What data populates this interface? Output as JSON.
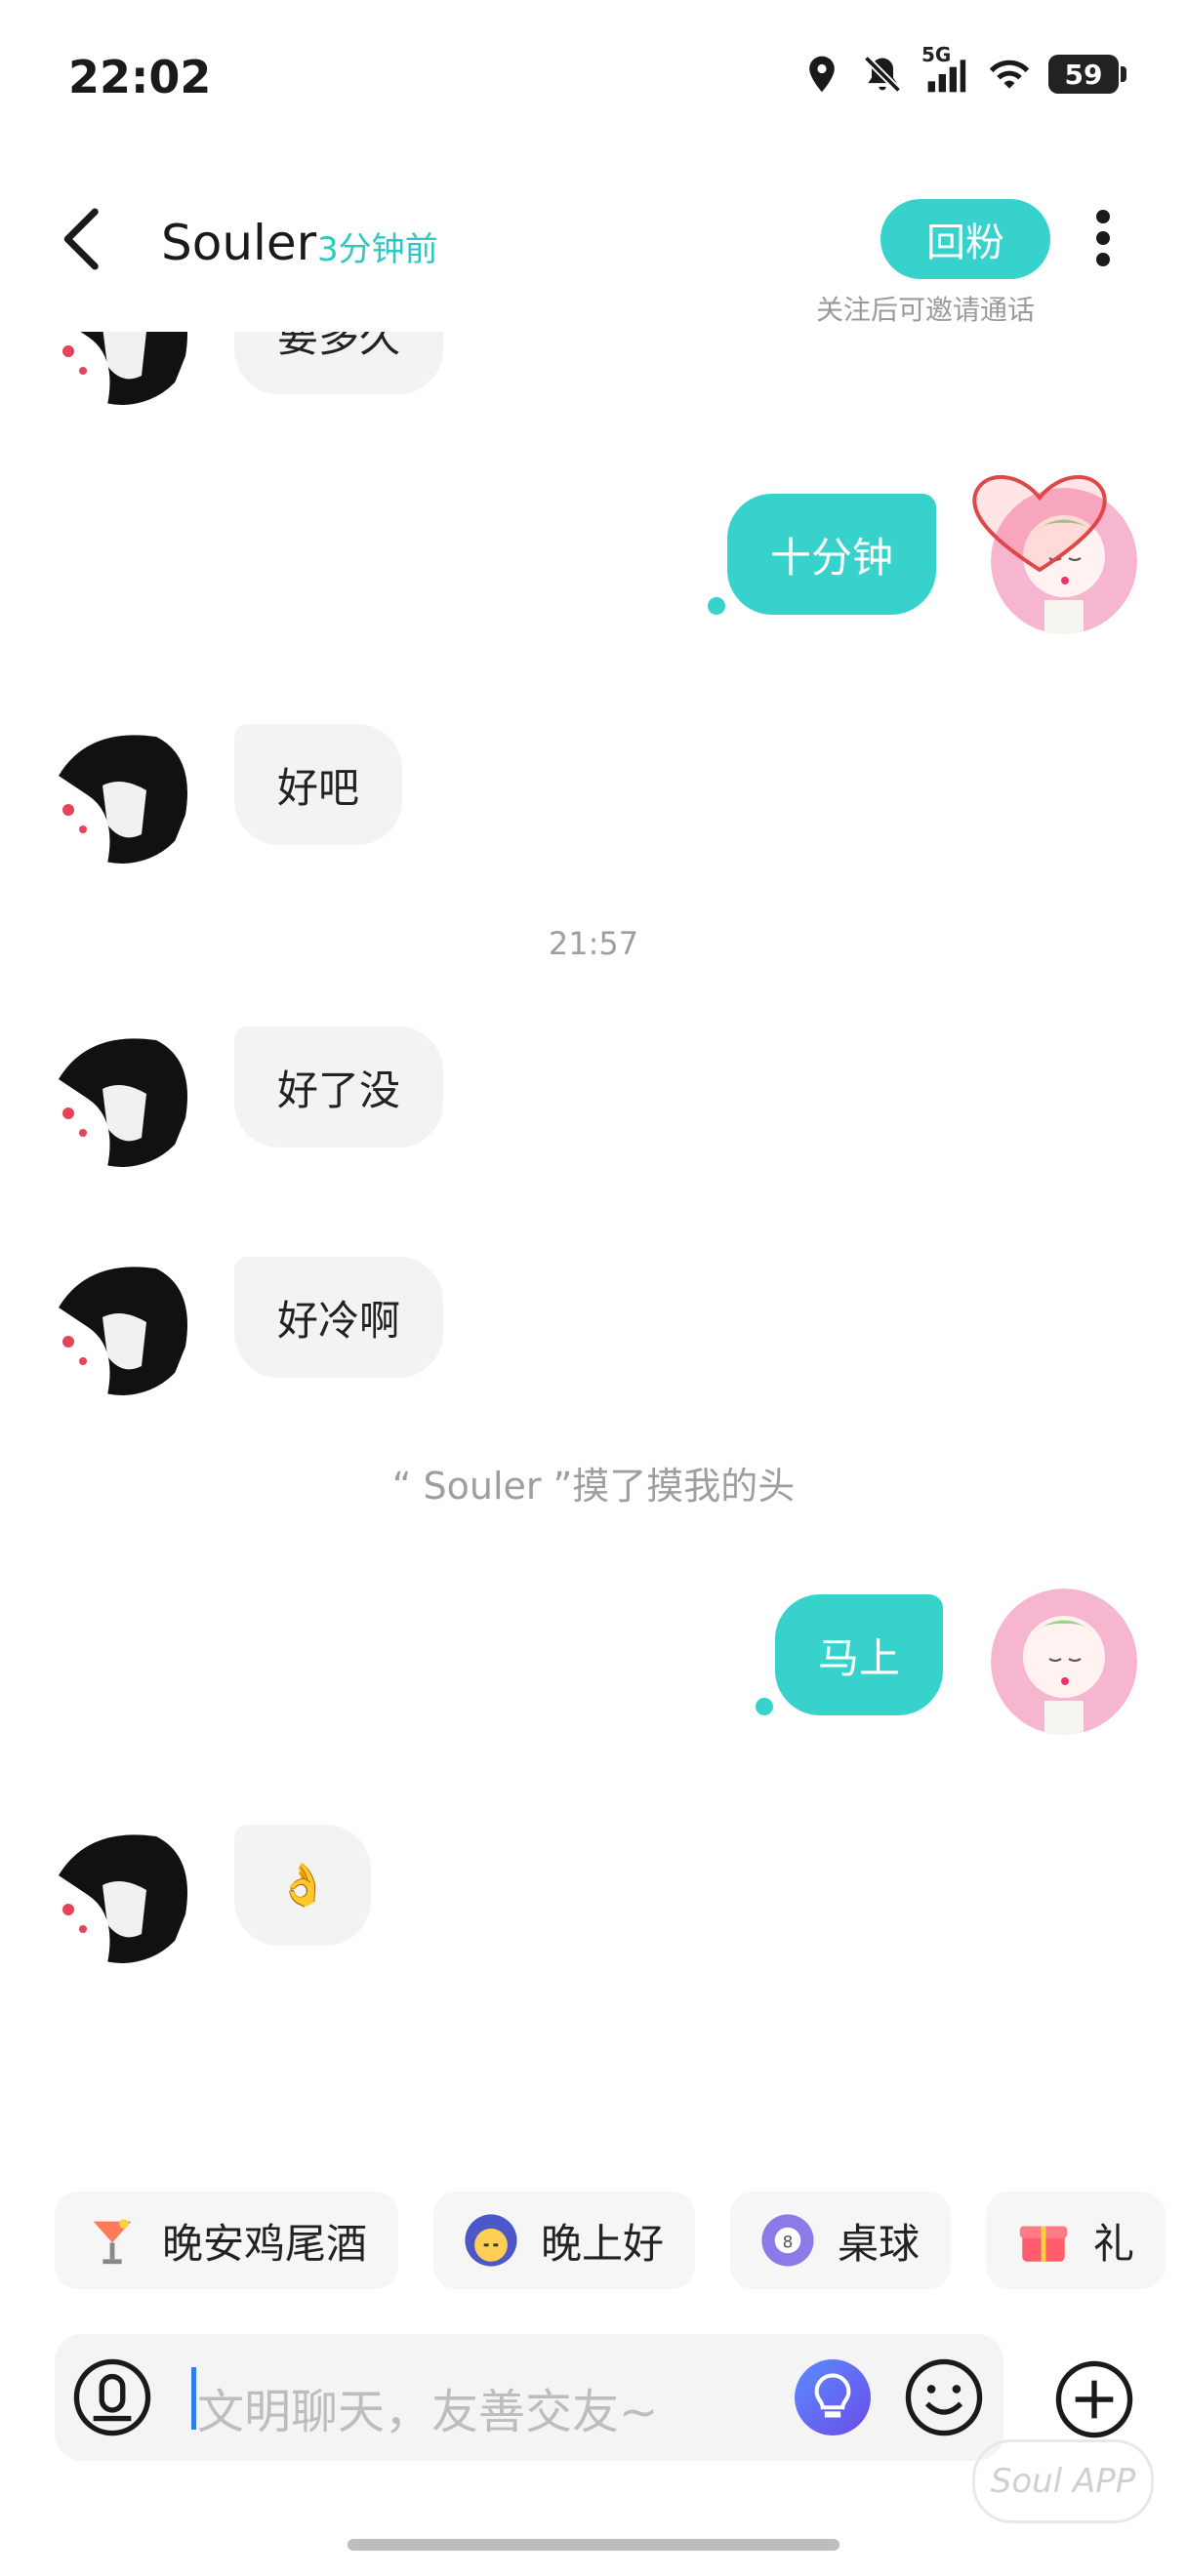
{
  "status_bar": {
    "time": "22:02",
    "battery": "59",
    "network": "5G"
  },
  "header": {
    "title": "Souler",
    "subtitle": "3分钟前",
    "follow_button": "回粉",
    "follow_hint": "关注后可邀请通话"
  },
  "messages": [
    {
      "side": "in",
      "text": "要多久"
    },
    {
      "side": "out",
      "text": "十分钟"
    },
    {
      "side": "in",
      "text": "好吧"
    },
    {
      "side": "time",
      "text": "21:57"
    },
    {
      "side": "in",
      "text": "好了没"
    },
    {
      "side": "in",
      "text": "好冷啊"
    },
    {
      "side": "system",
      "text": "“ Souler ”摸了摸我的头"
    },
    {
      "side": "out",
      "text": "马上"
    },
    {
      "side": "in",
      "text": "👌"
    }
  ],
  "suggestions": [
    {
      "label": "晚安鸡尾酒",
      "icon": "cocktail-icon"
    },
    {
      "label": "晚上好",
      "icon": "moon-face-icon"
    },
    {
      "label": "桌球",
      "icon": "billiard-ball-icon"
    },
    {
      "label": "礼",
      "icon": "gift-icon"
    }
  ],
  "input": {
    "placeholder": "文明聊天，友善交友~"
  },
  "watermark": "Soul APP",
  "colors": {
    "accent": "#37d2cc",
    "bubble_in": "#f3f3f3"
  }
}
